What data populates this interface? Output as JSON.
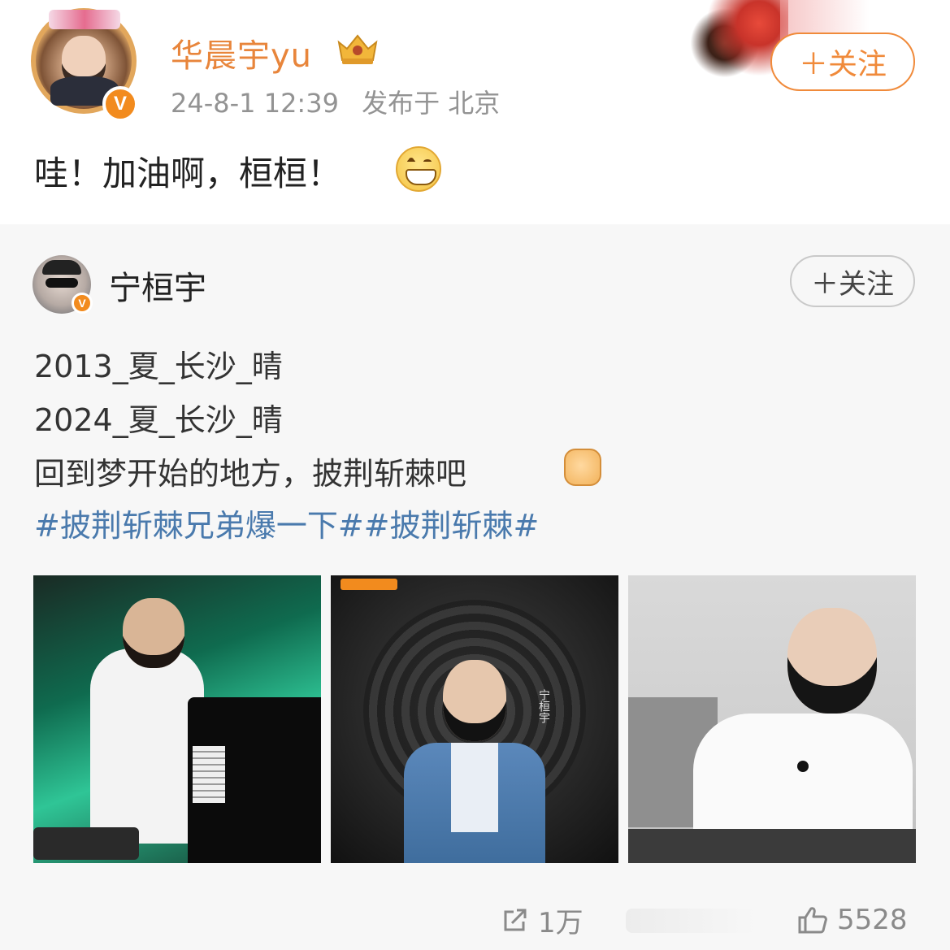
{
  "post": {
    "username": "华晨宇yu",
    "timestamp": "24-8-1 12:39",
    "location": "发布于 北京",
    "follow_label": "＋关注",
    "text": "哇！加油啊，桓桓！",
    "verified_label": "V"
  },
  "repost": {
    "username": "宁桓宇",
    "follow_label": "＋关注",
    "verified_label": "V",
    "lines": [
      "2013_夏_长沙_晴",
      "2024_夏_长沙_晴",
      "回到梦开始的地方，披荆斩棘吧"
    ],
    "hashtags": "#披荆斩棘兄弟爆一下##披荆斩棘#",
    "photos": [
      {
        "name": "photo-pianist-stage"
      },
      {
        "name": "photo-poster-blue-suit",
        "vertical_text": "宁桓宇"
      },
      {
        "name": "photo-keyboard-practice"
      }
    ]
  },
  "actions": {
    "share_count": "1万",
    "like_count": "5528"
  },
  "colors": {
    "accent_orange": "#e8853b",
    "hashtag_blue": "#4a7aad",
    "repost_bg": "#f7f7f7"
  }
}
